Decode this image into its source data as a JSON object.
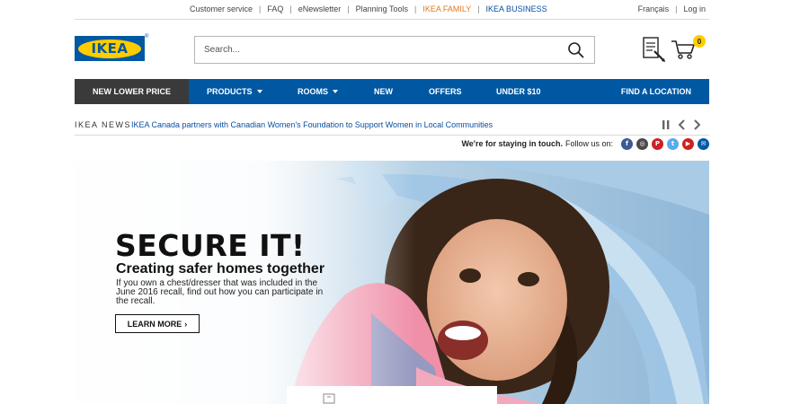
{
  "topbar": {
    "links": [
      "Customer service",
      "FAQ",
      "eNewsletter",
      "Planning Tools",
      "IKEA FAMILY",
      "IKEA BUSINESS"
    ],
    "right_links": [
      "Français",
      "Log in"
    ]
  },
  "header": {
    "logo_text": "IKEA",
    "logo_mark": "®",
    "search_placeholder": "Search...",
    "search_icon": "search-icon",
    "shopping_list_icon": "shopping-list-icon",
    "cart_icon": "cart-icon",
    "cart_count": "0"
  },
  "nav": {
    "items": [
      {
        "label": "NEW LOWER PRICE",
        "dropdown": false
      },
      {
        "label": "PRODUCTS",
        "dropdown": true
      },
      {
        "label": "ROOMS",
        "dropdown": true
      },
      {
        "label": "NEW",
        "dropdown": false
      },
      {
        "label": "OFFERS",
        "dropdown": false
      },
      {
        "label": "UNDER $10",
        "dropdown": false
      },
      {
        "label": "FIND A LOCATION",
        "dropdown": false
      }
    ]
  },
  "news": {
    "label": "IKEA NEWS",
    "headline": "IKEA Canada partners with Canadian Women's Foundation to Support Women in Local Communities",
    "controls": [
      "pause-icon",
      "chevron-left-icon",
      "chevron-right-icon"
    ]
  },
  "social": {
    "tagline": "We're for staying in touch.",
    "follow_label": "Follow us on:",
    "icons": [
      {
        "name": "facebook-icon",
        "glyph": "f",
        "color": "#3b5998"
      },
      {
        "name": "instagram-icon",
        "glyph": "◎",
        "color": "#4a4a4a"
      },
      {
        "name": "pinterest-icon",
        "glyph": "P",
        "color": "#cb2027"
      },
      {
        "name": "twitter-icon",
        "glyph": "t",
        "color": "#55acee"
      },
      {
        "name": "youtube-icon",
        "glyph": "▶",
        "color": "#cd201f"
      },
      {
        "name": "email-icon",
        "glyph": "✉",
        "color": "#0058a3"
      }
    ]
  },
  "hero": {
    "title": "SECURE IT!",
    "subtitle": "Creating safer homes together",
    "body": "If you own a chest/dresser that was included in the June 2016 recall, find out how you can participate in the recall.",
    "button_label": "LEARN MORE",
    "button_chevron": "›"
  },
  "colors": {
    "brand_blue": "#0058a3",
    "brand_yellow": "#ffcc00",
    "promo_dark": "#3a3a3a",
    "family_orange": "#e07a1f"
  }
}
